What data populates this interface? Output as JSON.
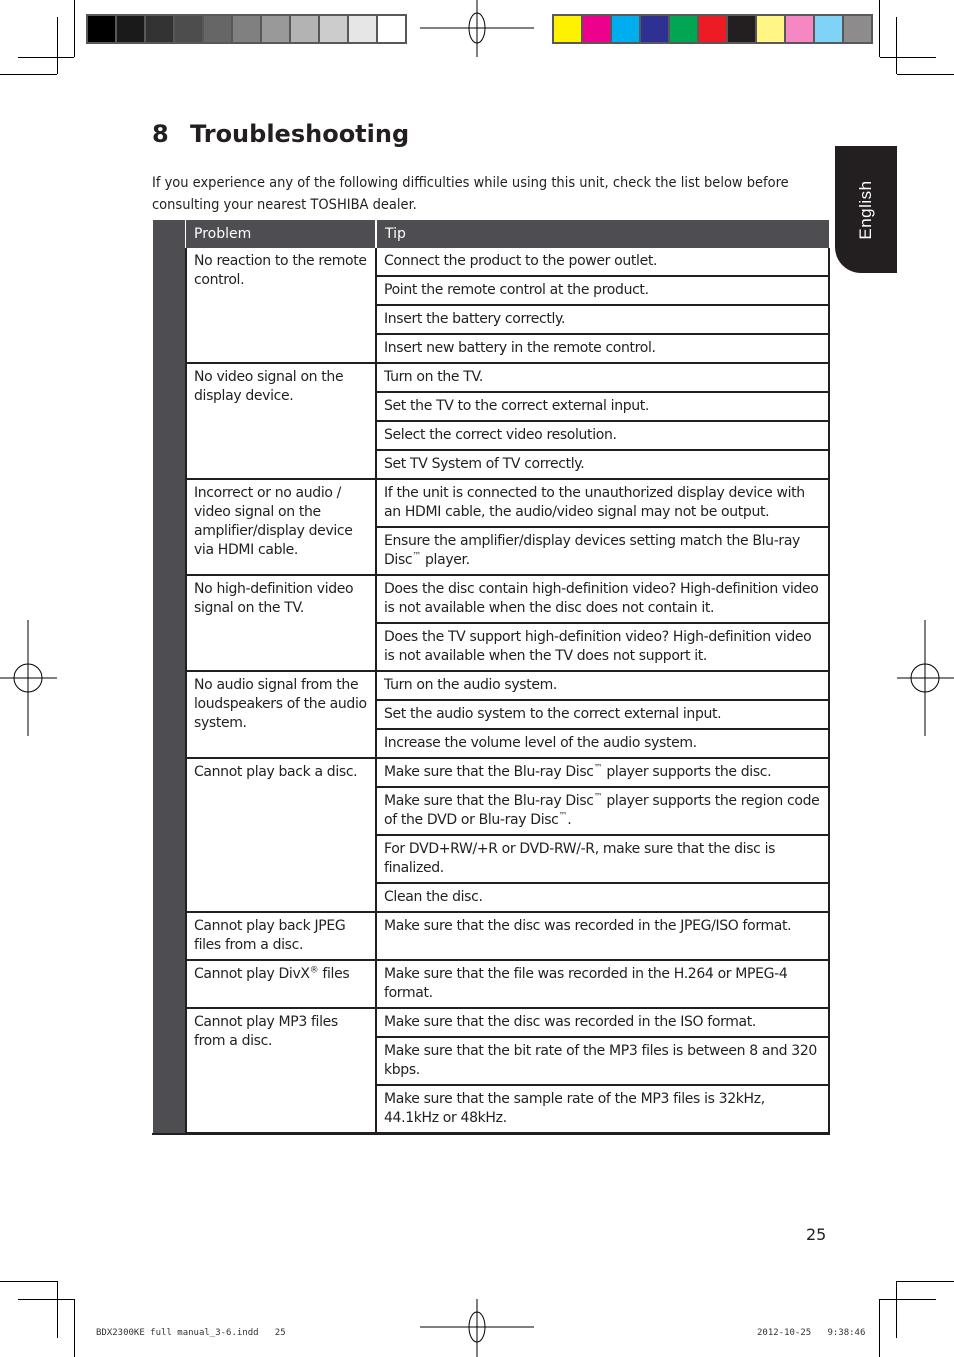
{
  "header": {
    "grayscale_bar": [
      "#000000",
      "#1a1a1a",
      "#333333",
      "#4d4d4d",
      "#666666",
      "#808080",
      "#999999",
      "#b3b3b3",
      "#cccccc",
      "#e6e6e6",
      "#ffffff"
    ],
    "color_bar": [
      "#fff200",
      "#ec008c",
      "#00aeef",
      "#2e3192",
      "#00a651",
      "#ed1c24",
      "#231f20",
      "#fff685",
      "#f587c3",
      "#7fd3f7",
      "#8d8b8c"
    ]
  },
  "lang_tab": {
    "label": "English"
  },
  "section": {
    "number": "8",
    "title": "Troubleshooting",
    "intro": "If you experience any of the following difficulties while using this unit, check the list below before consulting your nearest TOSHIBA dealer."
  },
  "table": {
    "headers": {
      "problem": "Problem",
      "tip": "Tip"
    },
    "groups": [
      {
        "problem": "No reaction to the remote control.",
        "tips": [
          "Connect the product to the power outlet.",
          "Point the remote control at the product.",
          "Insert the battery correctly.",
          "Insert new battery in the remote control."
        ]
      },
      {
        "problem": "No video signal on the display device.",
        "tips": [
          "Turn on the TV.",
          "Set the TV to the correct external input.",
          "Select the correct video resolution.",
          "Set TV System of TV correctly."
        ]
      },
      {
        "problem": "Incorrect or no audio / video signal on the amplifier/display device via HDMI cable.",
        "tips": [
          "If the unit is connected to the unauthorized display device with an HDMI cable, the audio/video signal may not be output.",
          "Ensure the amplifier/display devices setting match the Blu-ray Disc™ player."
        ]
      },
      {
        "problem": "No high-definition video signal on the TV.",
        "tips": [
          "Does the disc contain high-definition video? High-definition video is not available when the disc does not contain it.",
          "Does the TV support high-definition video? High-definition video is not available when the TV does not support it."
        ]
      },
      {
        "problem": "No audio signal from the loudspeakers of the audio system.",
        "tips": [
          "Turn on the audio system.",
          "Set the audio system to the correct external input.",
          "Increase the volume level of the audio system."
        ]
      },
      {
        "problem": "Cannot play back a disc.",
        "tips": [
          "Make sure that the Blu-ray Disc™ player supports the disc.",
          "Make sure that the Blu-ray Disc™ player supports the region code of the DVD or Blu-ray Disc™.",
          "For DVD+RW/+R or DVD-RW/-R, make sure that the disc is finalized.",
          "Clean the disc."
        ]
      },
      {
        "problem": "Cannot play back JPEG files from a disc.",
        "tips": [
          "Make sure that the disc was recorded in the JPEG/ISO format."
        ]
      },
      {
        "problem": "Cannot play DivX® files",
        "tips": [
          "Make sure that the file was recorded in the H.264 or MPEG-4 format."
        ]
      },
      {
        "problem": "Cannot play MP3 files from a disc.",
        "tips": [
          "Make sure that the disc was recorded in the ISO format.",
          "Make sure that the bit rate of the MP3 files is between 8 and 320 kbps.",
          "Make sure that the sample rate of the MP3 files is 32kHz, 44.1kHz or 48kHz."
        ]
      }
    ]
  },
  "footer": {
    "page_number": "25",
    "slug_file": "BDX2300KE full manual_3-6.indd   25",
    "slug_date": "2012-10-25   9:38:46"
  }
}
